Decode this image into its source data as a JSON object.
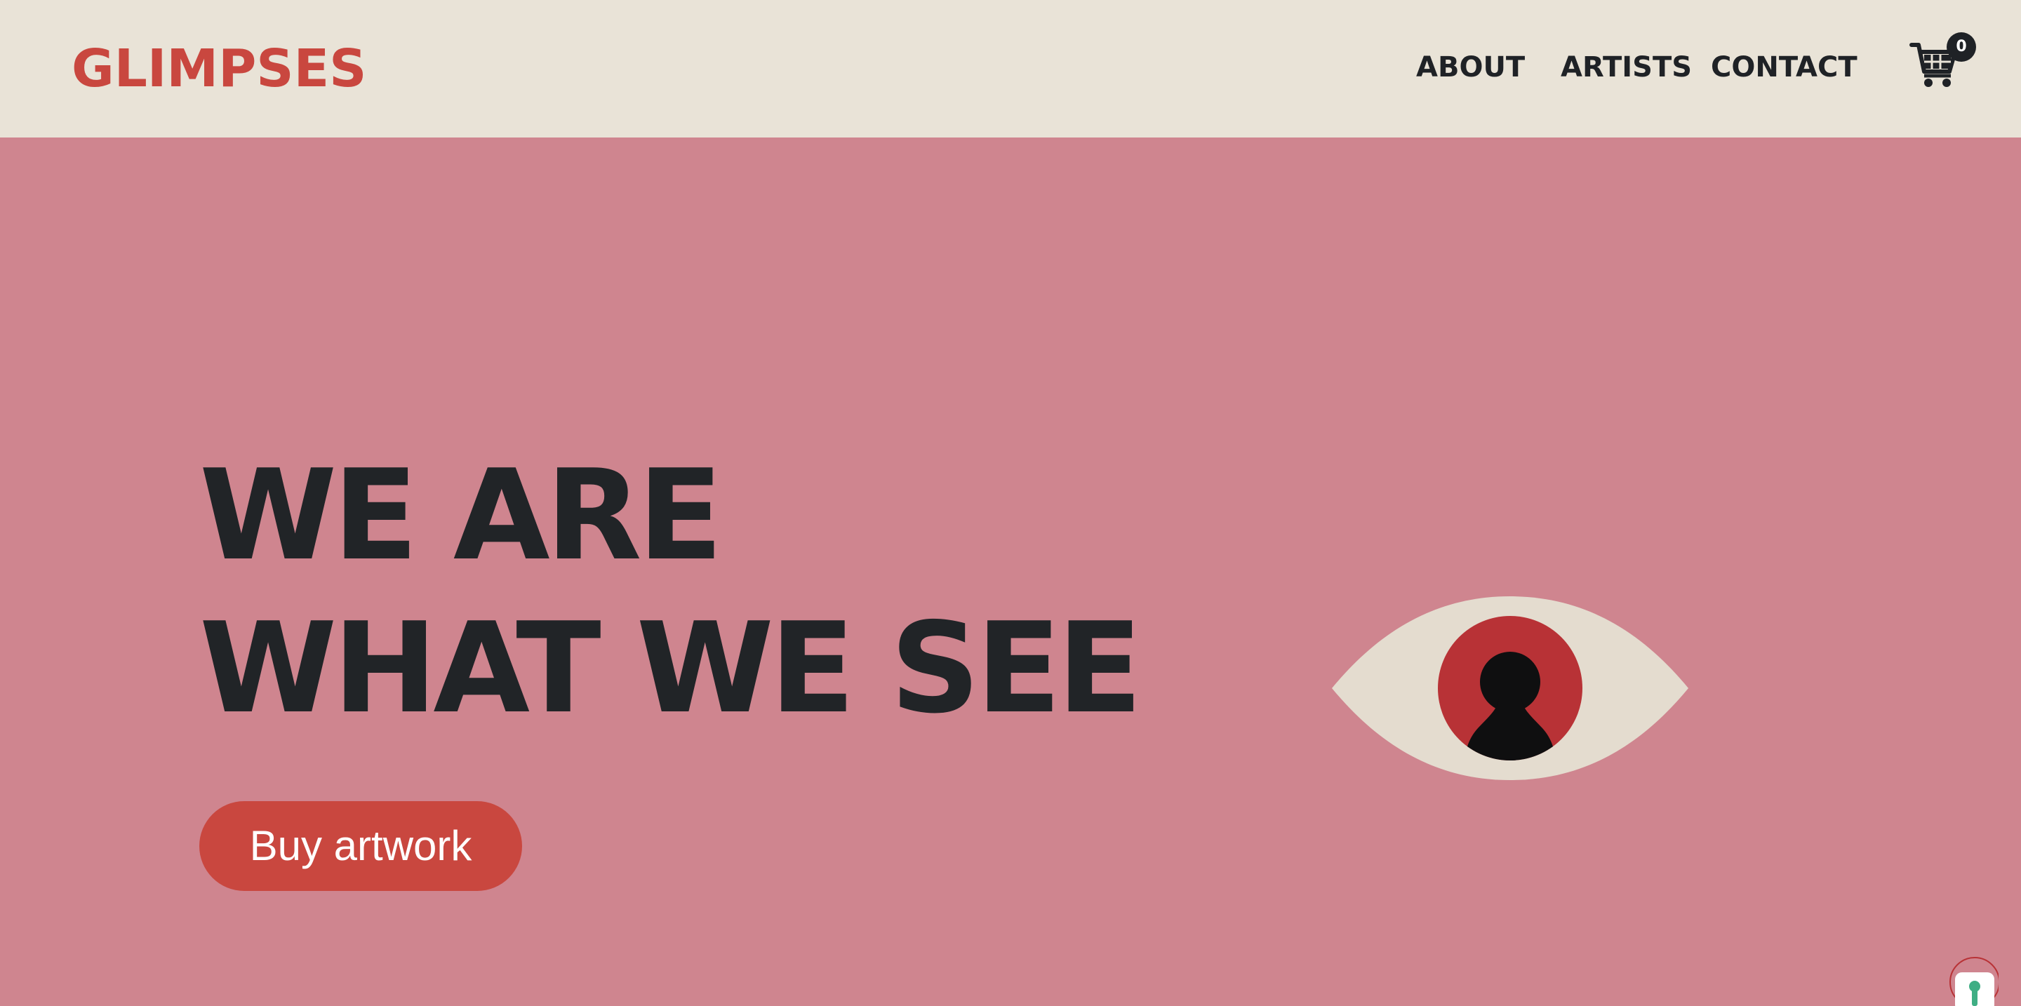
{
  "brand": {
    "name": "GLIMPSES",
    "color": "#c9473f"
  },
  "nav": {
    "items": [
      {
        "label": "ABOUT"
      },
      {
        "label": "ARTISTS"
      },
      {
        "label": "CONTACT"
      }
    ]
  },
  "cart": {
    "icon": "shopping-cart-icon",
    "count": "0"
  },
  "hero": {
    "headline_line1": "WE ARE",
    "headline_line2": "WHAT WE SEE",
    "cta_label": "Buy artwork",
    "illustration": "eye-keyhole-icon"
  },
  "colors": {
    "header_bg": "#e9e3d7",
    "hero_bg": "#cf858f",
    "accent": "#c9473f",
    "text_dark": "#212427"
  },
  "widget": {
    "icon": "keyhole-icon"
  }
}
